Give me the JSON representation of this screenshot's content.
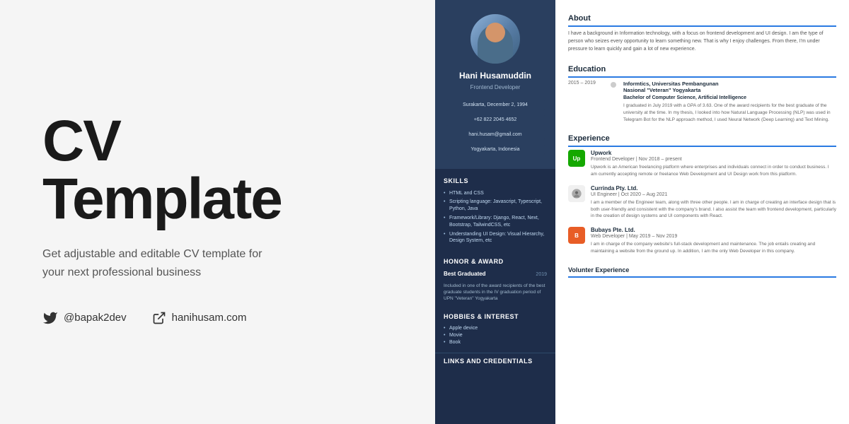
{
  "left": {
    "title_line1": "CV",
    "title_line2": "Template",
    "subtitle": "Get adjustable and editable CV template for your next professional business",
    "social": {
      "twitter_handle": "@bapak2dev",
      "website": "hanihusam.com"
    }
  },
  "cv": {
    "name": "Hani Husamuddin",
    "role": "Frontend Developer",
    "info": {
      "location_birth": "Surakarta, December 2, 1994",
      "phone": "+62 822 2045 4652",
      "email": "hani.husam@gmail.com",
      "city": "Yogyakarta, Indonesia"
    },
    "skills_title": "Skills",
    "skills": [
      "HTML and CSS",
      "Scripting language: Javascript, Typescript, Python, Java",
      "Framework/Library: Django, React, Next, Bootstrap, TailwindCSS, etc",
      "Understanding UI Design: Visual Hierarchy, Design System, etc"
    ],
    "honor_title": "Honor & Award",
    "honor_name": "Best Graduated",
    "honor_year": "2019",
    "honor_desc": "Included in one of the award recipients of the best graduate students in the IV graduation period of UPN \"Veteran\" Yogyakarta",
    "hobbies_title": "Hobbies & Interest",
    "hobbies": [
      "Apple device",
      "Movie",
      "Book"
    ],
    "links_title": "Links and Credentials",
    "about_title": "About",
    "about_text": "I have a background in Information technology, with a focus on frontend development and UI design. I am the type of person who seizes every opportunity to learn something new. That is why I enjoy challenges. From there, I'm under pressure to learn quickly and gain a lot of new experience.",
    "education_title": "Education",
    "education": [
      {
        "years": "2015 – 2019",
        "school": "Informtics, Universitas Pembangunan Nasional \"Veteran\" Yogyakarta",
        "degree": "Bachelor of Computer Science, Artificial Intelligence",
        "desc": "I graduated in July 2019 with a GPA of 3.63. One of the award recipients for the best graduate of the university at the time. In my thesis, I looked into how Natural Language Processing (NLP) was used in Telegram Bot for the NLP approach method, I used Neural Network (Deep Learning) and Text Mining."
      }
    ],
    "experience_title": "Experience",
    "experience": [
      {
        "company": "Upwork",
        "logo_type": "upwork",
        "logo_text": "Up",
        "role_date": "Frontend Developer  |  Nov 2018 – present",
        "desc": "Upwork is an American freelancing platform where enterprises and individuals connect in order to conduct business. I am currently accepting remote or freelance Web Development and UI Design work from this platform."
      },
      {
        "company": "Currinda Pty. Ltd.",
        "logo_type": "currinda",
        "logo_text": "🐦",
        "role_date": "UI Engineer  |  Oct 2020 – Aug 2021",
        "desc": "I am a member of the Engineer team, along with three other people. I am in charge of creating an interface design that is both user-friendly and consistent with the company's brand. I also assist the team with frontend development, particularly in the creation of design systems and UI components with React."
      },
      {
        "company": "Bubays Pte. Ltd.",
        "logo_type": "bubays",
        "logo_text": "B",
        "role_date": "Web Developer  |  May 2019 – Nov 2019",
        "desc": "I am in charge of the company website's full-stack development and maintenance. The job entails creating and maintaining a website from the ground up. In addition, I am the only Web Developer in this company."
      }
    ],
    "volunteer_title": "Volunter Experience"
  }
}
